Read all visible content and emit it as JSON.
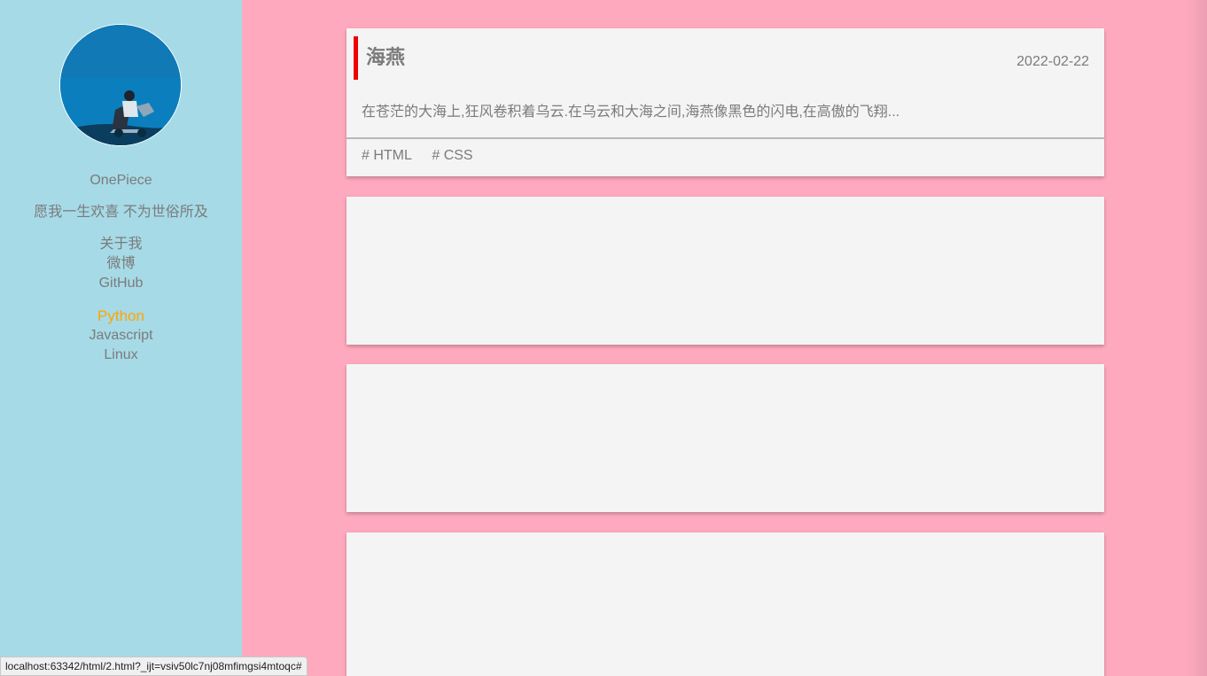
{
  "sidebar": {
    "profile_name": "OnePiece",
    "motto": "愿我一生欢喜 不为世俗所及",
    "links": [
      "关于我",
      "微博",
      "GitHub"
    ],
    "categories": [
      {
        "label": "Python",
        "active": true
      },
      {
        "label": "Javascript",
        "active": false
      },
      {
        "label": "Linux",
        "active": false
      }
    ]
  },
  "posts": [
    {
      "title": "海燕",
      "date": "2022-02-22",
      "excerpt": "在苍茫的大海上,狂风卷积着乌云.在乌云和大海之间,海燕像黑色的闪电,在高傲的飞翔...",
      "tags": [
        "# HTML",
        "# CSS"
      ]
    }
  ],
  "status_bar": {
    "url": "localhost:63342/html/2.html?_ijt=vsiv50lc7nj08mfimgsi4mtoqc#"
  },
  "colors": {
    "page_background": "#ffa9be",
    "sidebar_background": "#a6dae7",
    "card_background": "#f4f4f4",
    "title_accent": "#ee0000",
    "active_category": "#ffa500",
    "text": "#7b7b7b"
  }
}
